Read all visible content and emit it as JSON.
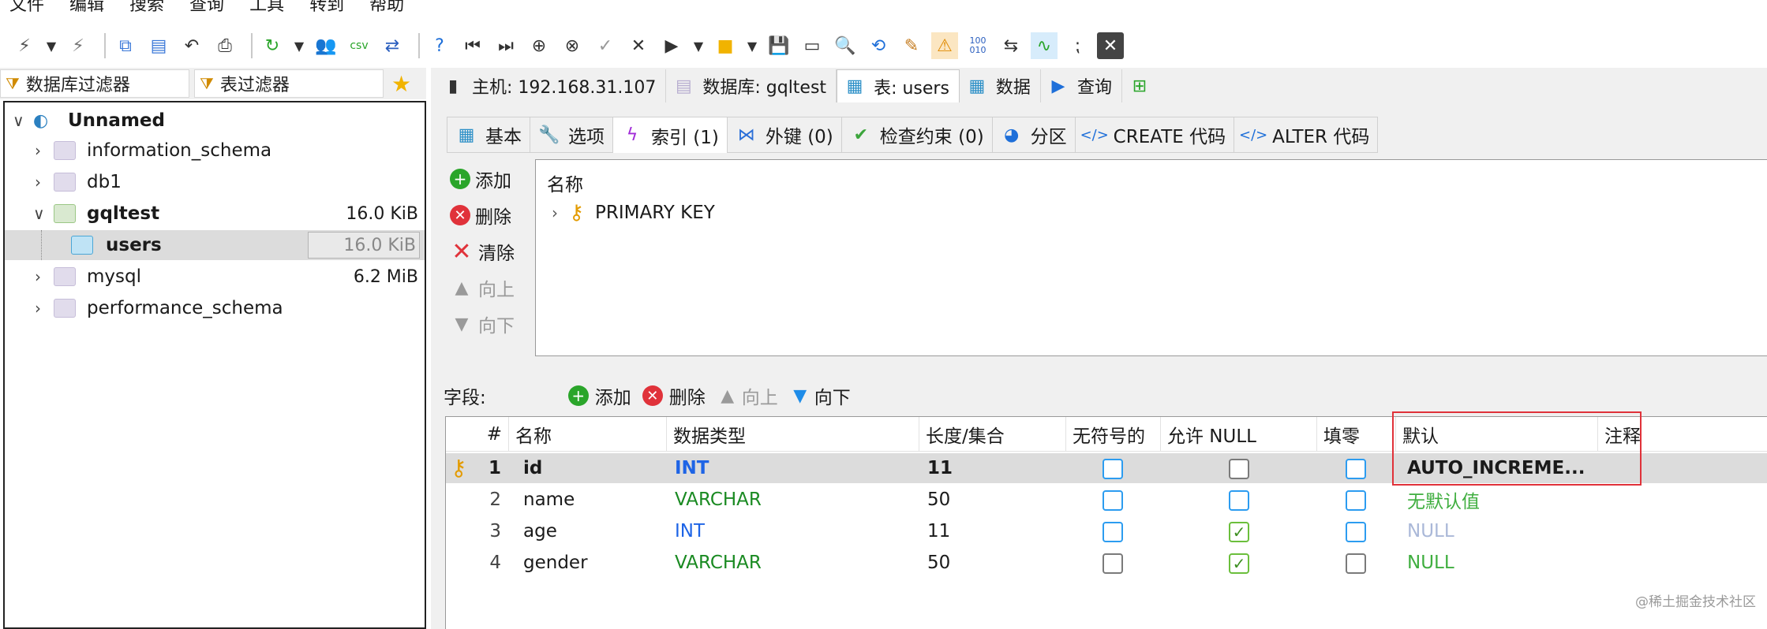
{
  "menu": [
    "文件",
    "编辑",
    "搜索",
    "查询",
    "工具",
    "转到",
    "帮助"
  ],
  "toolbar_icons": [
    "connect-icon",
    "dropdown-icon",
    "disconnect-icon",
    "copy-icon",
    "paste-icon",
    "undo-icon",
    "print-icon",
    "refresh-icon",
    "dropdown-icon",
    "users-icon",
    "csv-icon",
    "transfer-icon",
    "help-icon",
    "first-icon",
    "last-icon",
    "add-icon",
    "delete-icon",
    "apply-icon",
    "cancel-icon",
    "run-icon",
    "dropdown-icon",
    "folder-icon",
    "dropdown-icon",
    "save-icon",
    "server-icon",
    "find-icon",
    "replace-icon",
    "clear-icon",
    "warning-icon",
    "binary-icon",
    "wrap-icon",
    "sync-icon",
    "more-icon",
    "close-icon"
  ],
  "filters": {
    "db": "数据库过滤器",
    "table": "表过滤器"
  },
  "tree": {
    "root": "Unnamed",
    "items": [
      {
        "name": "information_schema",
        "size": ""
      },
      {
        "name": "db1",
        "size": ""
      },
      {
        "name": "gqltest",
        "size": "16.0 KiB"
      },
      {
        "name": "users",
        "size": "16.0 KiB"
      },
      {
        "name": "mysql",
        "size": "6.2 MiB"
      },
      {
        "name": "performance_schema",
        "size": ""
      }
    ]
  },
  "main_tabs": [
    {
      "label": "主机: 192.168.31.107"
    },
    {
      "label": "数据库: gqltest"
    },
    {
      "label": "表: users"
    },
    {
      "label": "数据"
    },
    {
      "label": "查询"
    }
  ],
  "sub_tabs": [
    {
      "label": "基本"
    },
    {
      "label": "选项"
    },
    {
      "label": "索引 (1)"
    },
    {
      "label": "外键 (0)"
    },
    {
      "label": "检查约束 (0)"
    },
    {
      "label": "分区"
    },
    {
      "label": "CREATE 代码"
    },
    {
      "label": "ALTER 代码"
    }
  ],
  "index_buttons": {
    "add": "添加",
    "delete": "删除",
    "clear": "清除",
    "up": "向上",
    "down": "向下"
  },
  "index_panel": {
    "header": "名称",
    "row": "PRIMARY KEY"
  },
  "fields_bar": {
    "label": "字段:",
    "add": "添加",
    "delete": "删除",
    "up": "向上",
    "down": "向下"
  },
  "grid": {
    "columns": [
      "#",
      "名称",
      "数据类型",
      "长度/集合",
      "无符号的",
      "允许 NULL",
      "填零",
      "默认",
      "注释"
    ],
    "rows": [
      {
        "num": "1",
        "name": "id",
        "type": "INT",
        "length": "11",
        "default": "AUTO_INCREME..."
      },
      {
        "num": "2",
        "name": "name",
        "type": "VARCHAR",
        "length": "50",
        "default": "无默认值"
      },
      {
        "num": "3",
        "name": "age",
        "type": "INT",
        "length": "11",
        "default": "NULL"
      },
      {
        "num": "4",
        "name": "gender",
        "type": "VARCHAR",
        "length": "50",
        "default": "NULL"
      }
    ]
  },
  "watermark": "@稀土掘金技术社区",
  "colors": {
    "blue": "#1e64e6",
    "green": "#1a8a22",
    "highlight_row": "#dcdcdc",
    "red_box": "#e0323a"
  }
}
